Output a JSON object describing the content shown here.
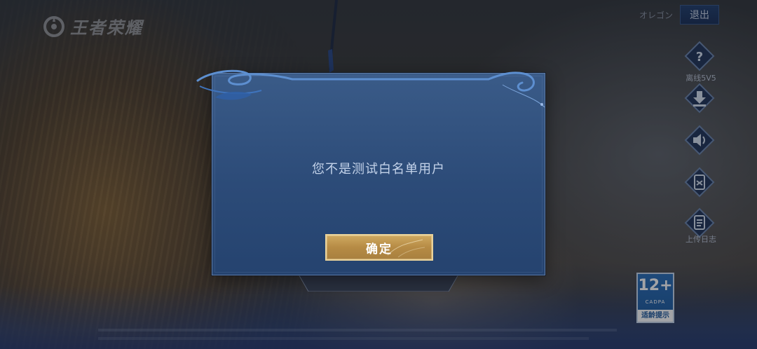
{
  "app": {
    "logo_text": "王者荣耀"
  },
  "header": {
    "user_name": "オレゴン",
    "logout_label": "退出"
  },
  "sidebar": {
    "items": [
      {
        "icon": "question-icon",
        "label": "离线5V5"
      },
      {
        "icon": "download-icon",
        "label": ""
      },
      {
        "icon": "volume-icon",
        "label": ""
      },
      {
        "icon": "clipboard-icon",
        "label": ""
      },
      {
        "icon": "notice-icon",
        "label": "上传日志"
      }
    ]
  },
  "age_rating": {
    "age": "12+",
    "org": "CADPA",
    "caption": "适龄提示"
  },
  "dialog": {
    "message": "您不是测试白名单用户",
    "confirm_label": "确定"
  },
  "colors": {
    "dialog_bg": "#2c4b78",
    "confirm_gold": "#b68b45",
    "logout_bg": "#1b3158",
    "age_badge_blue": "#1f5a9d"
  }
}
